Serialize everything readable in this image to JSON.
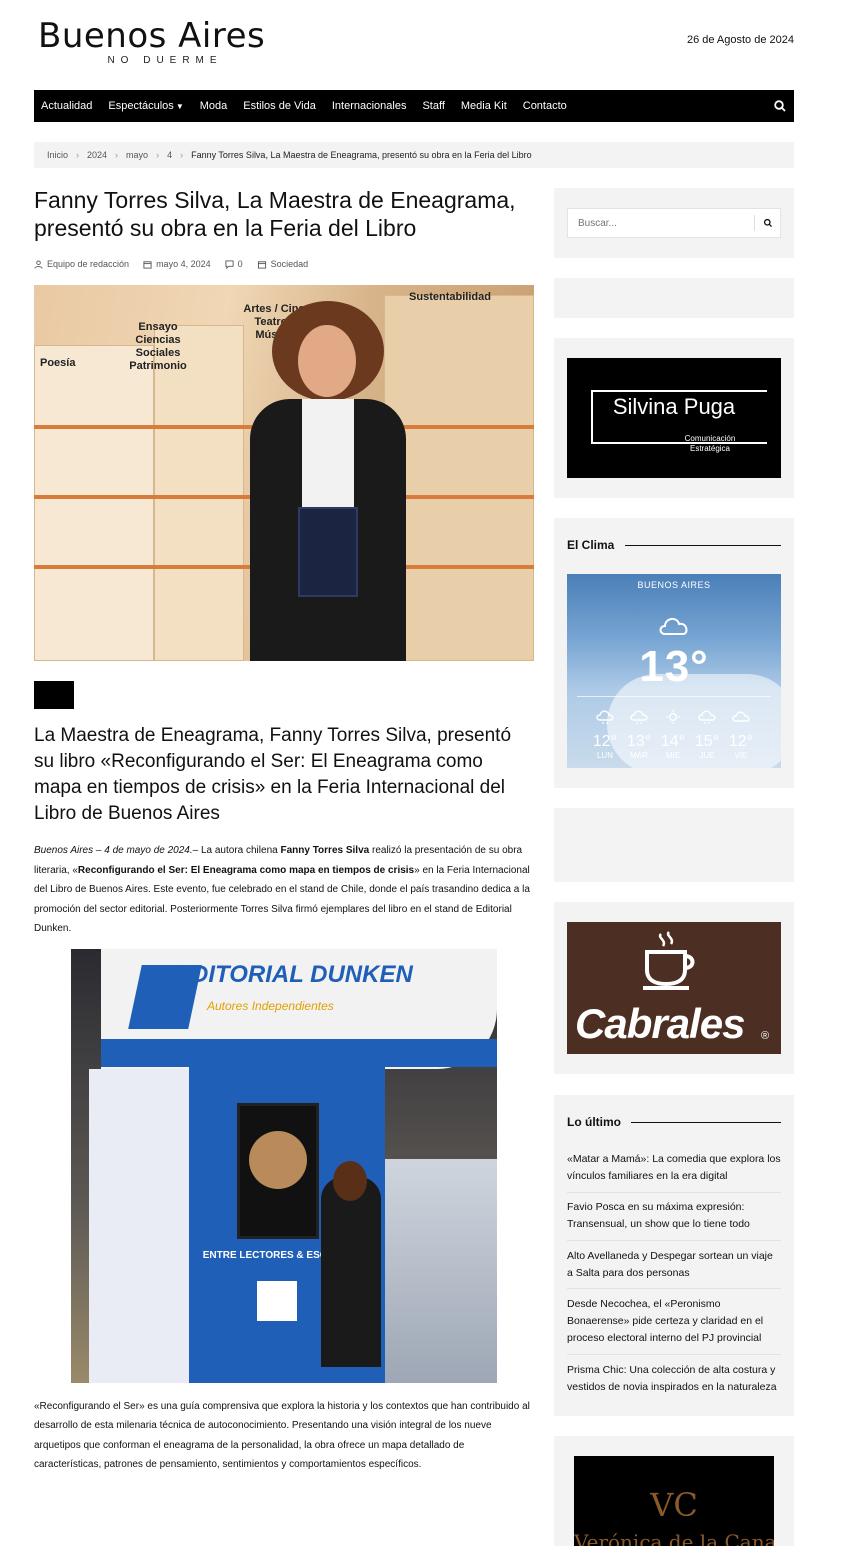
{
  "site": {
    "logo_main": "Buenos Aires",
    "logo_sub": "NO DUERME",
    "date": "26 de Agosto de 2024"
  },
  "nav": {
    "items": [
      "Actualidad",
      "Espectáculos",
      "Moda",
      "Estilos de Vida",
      "Internacionales",
      "Staff",
      "Media Kit",
      "Contacto"
    ],
    "icon": "search-icon"
  },
  "breadcrumb": [
    "Inicio",
    "2024",
    "mayo",
    "4",
    "Fanny Torres Silva, La Maestra de Eneagrama, presentó su obra en la Feria del Libro"
  ],
  "article": {
    "title": "Fanny Torres Silva, La Maestra de Eneagrama, presentó su obra en la Feria del Libro",
    "author": "Equipo de redacción",
    "date": "mayo 4, 2024",
    "comments": "0",
    "category": "Sociedad",
    "hero_signs": [
      "Poesía",
      "Ensayo Ciencias Sociales Patrimonio",
      "Artes / Cine Teatro / Música",
      "Sustentabilidad"
    ],
    "subtitle": "La Maestra de Eneagrama, Fanny Torres Silva, presentó su libro «Reconfigurando el Ser: El Eneagrama como mapa en tiempos de crisis» en la Feria Internacional del Libro de Buenos Aires",
    "p1_lead": "Buenos Aires – 4 de mayo de 2024.",
    "p1_a": "– La autora chilena ",
    "p1_name": "Fanny Torres Silva",
    "p1_b": " realizó la presentación de su obra literaria, «",
    "p1_book": "Reconfigurando el Ser: El Eneagrama como mapa en tiempos de crisis",
    "p1_c": "» en la Feria Internacional del Libro de Buenos Aires. Este evento, fue celebrado en el stand de Chile, donde el país trasandino dedica a la promoción del sector editorial. Posteriormente Torres Silva firmó ejemplares del libro en el stand de Editorial Dunken.",
    "stand_brand": "EDITORIAL DUNKEN",
    "stand_tagline": "Autores Independientes",
    "stand_slogan": "ENTRE LECTORES & ESCRITORES",
    "p2": "«Reconfigurando el Ser» es una guía comprensiva que explora la historia y los contextos que han contribuido al desarrollo de esta milenaria técnica de autoconocimiento. Presentando una visión integral de los nueve arquetipos que conforman el eneagrama de la personalidad, la obra ofrece un mapa detallado de características, patrones de pensamiento, sentimientos y comportamientos específicos."
  },
  "sidebar": {
    "search_placeholder": "Buscar...",
    "ad1": {
      "title": "Silvina Puga",
      "sub1": "Comunicación",
      "sub2": "Estratégica"
    },
    "weather_title": "El Clima",
    "weather": {
      "city": "BUENOS AIRES",
      "temp": "13°",
      "days": [
        {
          "t": "12°",
          "d": "LUN",
          "icon": "snow-cloud-icon"
        },
        {
          "t": "13°",
          "d": "MAR",
          "icon": "snow-cloud-icon"
        },
        {
          "t": "14°",
          "d": "MIE",
          "icon": "sun-icon"
        },
        {
          "t": "15°",
          "d": "JUE",
          "icon": "snow-cloud-icon"
        },
        {
          "t": "12°",
          "d": "VIE",
          "icon": "cloud-icon"
        }
      ]
    },
    "ad2": {
      "brand": "Cabrales",
      "mark": "®"
    },
    "latest_title": "Lo último",
    "latest": [
      "«Matar a Mamá»: La comedia que explora los vínculos familiares en la era digital",
      "Favio Posca en su máxima expresión: Transensual, un show que lo tiene todo",
      "Alto Avellaneda y Despegar sortean un viaje a Salta para dos personas",
      "Desde Necochea, el «Peronismo Bonaerense» pide certeza y claridad en el proceso electoral interno del PJ provincial",
      "Prisma Chic: Una colección de alta costura y vestidos de novia inspirados en la naturaleza"
    ],
    "ad3": {
      "initials": "VC",
      "name": "Verónica de la Canal"
    }
  },
  "colors": {
    "nav_bg": "#000000",
    "widget_bg": "#f3f3f3",
    "cabrales_bg": "#4d2e22",
    "dunken_blue": "#1f5fb8"
  }
}
